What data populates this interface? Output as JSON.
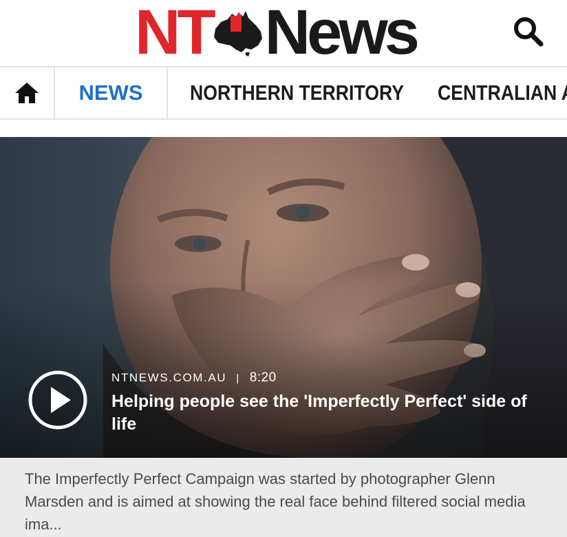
{
  "header": {
    "logo_left": "NT",
    "logo_right": "News",
    "logo_icon": "australia-map-icon",
    "search_icon": "search-icon",
    "brand_red": "#e0262a",
    "brand_dark": "#1a1a1a"
  },
  "nav": {
    "home_icon": "home-icon",
    "tabs": [
      {
        "label": "NEWS",
        "active": true
      },
      {
        "label": "NORTHERN TERRITORY",
        "active": false
      },
      {
        "label": "CENTRALIAN A",
        "active": false
      }
    ],
    "active_color": "#1f6fc9"
  },
  "hero": {
    "play_icon": "play-icon",
    "source": "NTNEWS.COM.AU",
    "separator": "|",
    "duration": "8:20",
    "headline": "Helping people see the 'Imperfectly Perfect' side of life"
  },
  "summary": {
    "text": "The Imperfectly Perfect Campaign was started by photographer Glenn Marsden and is aimed at showing the real face behind filtered social media ima..."
  }
}
